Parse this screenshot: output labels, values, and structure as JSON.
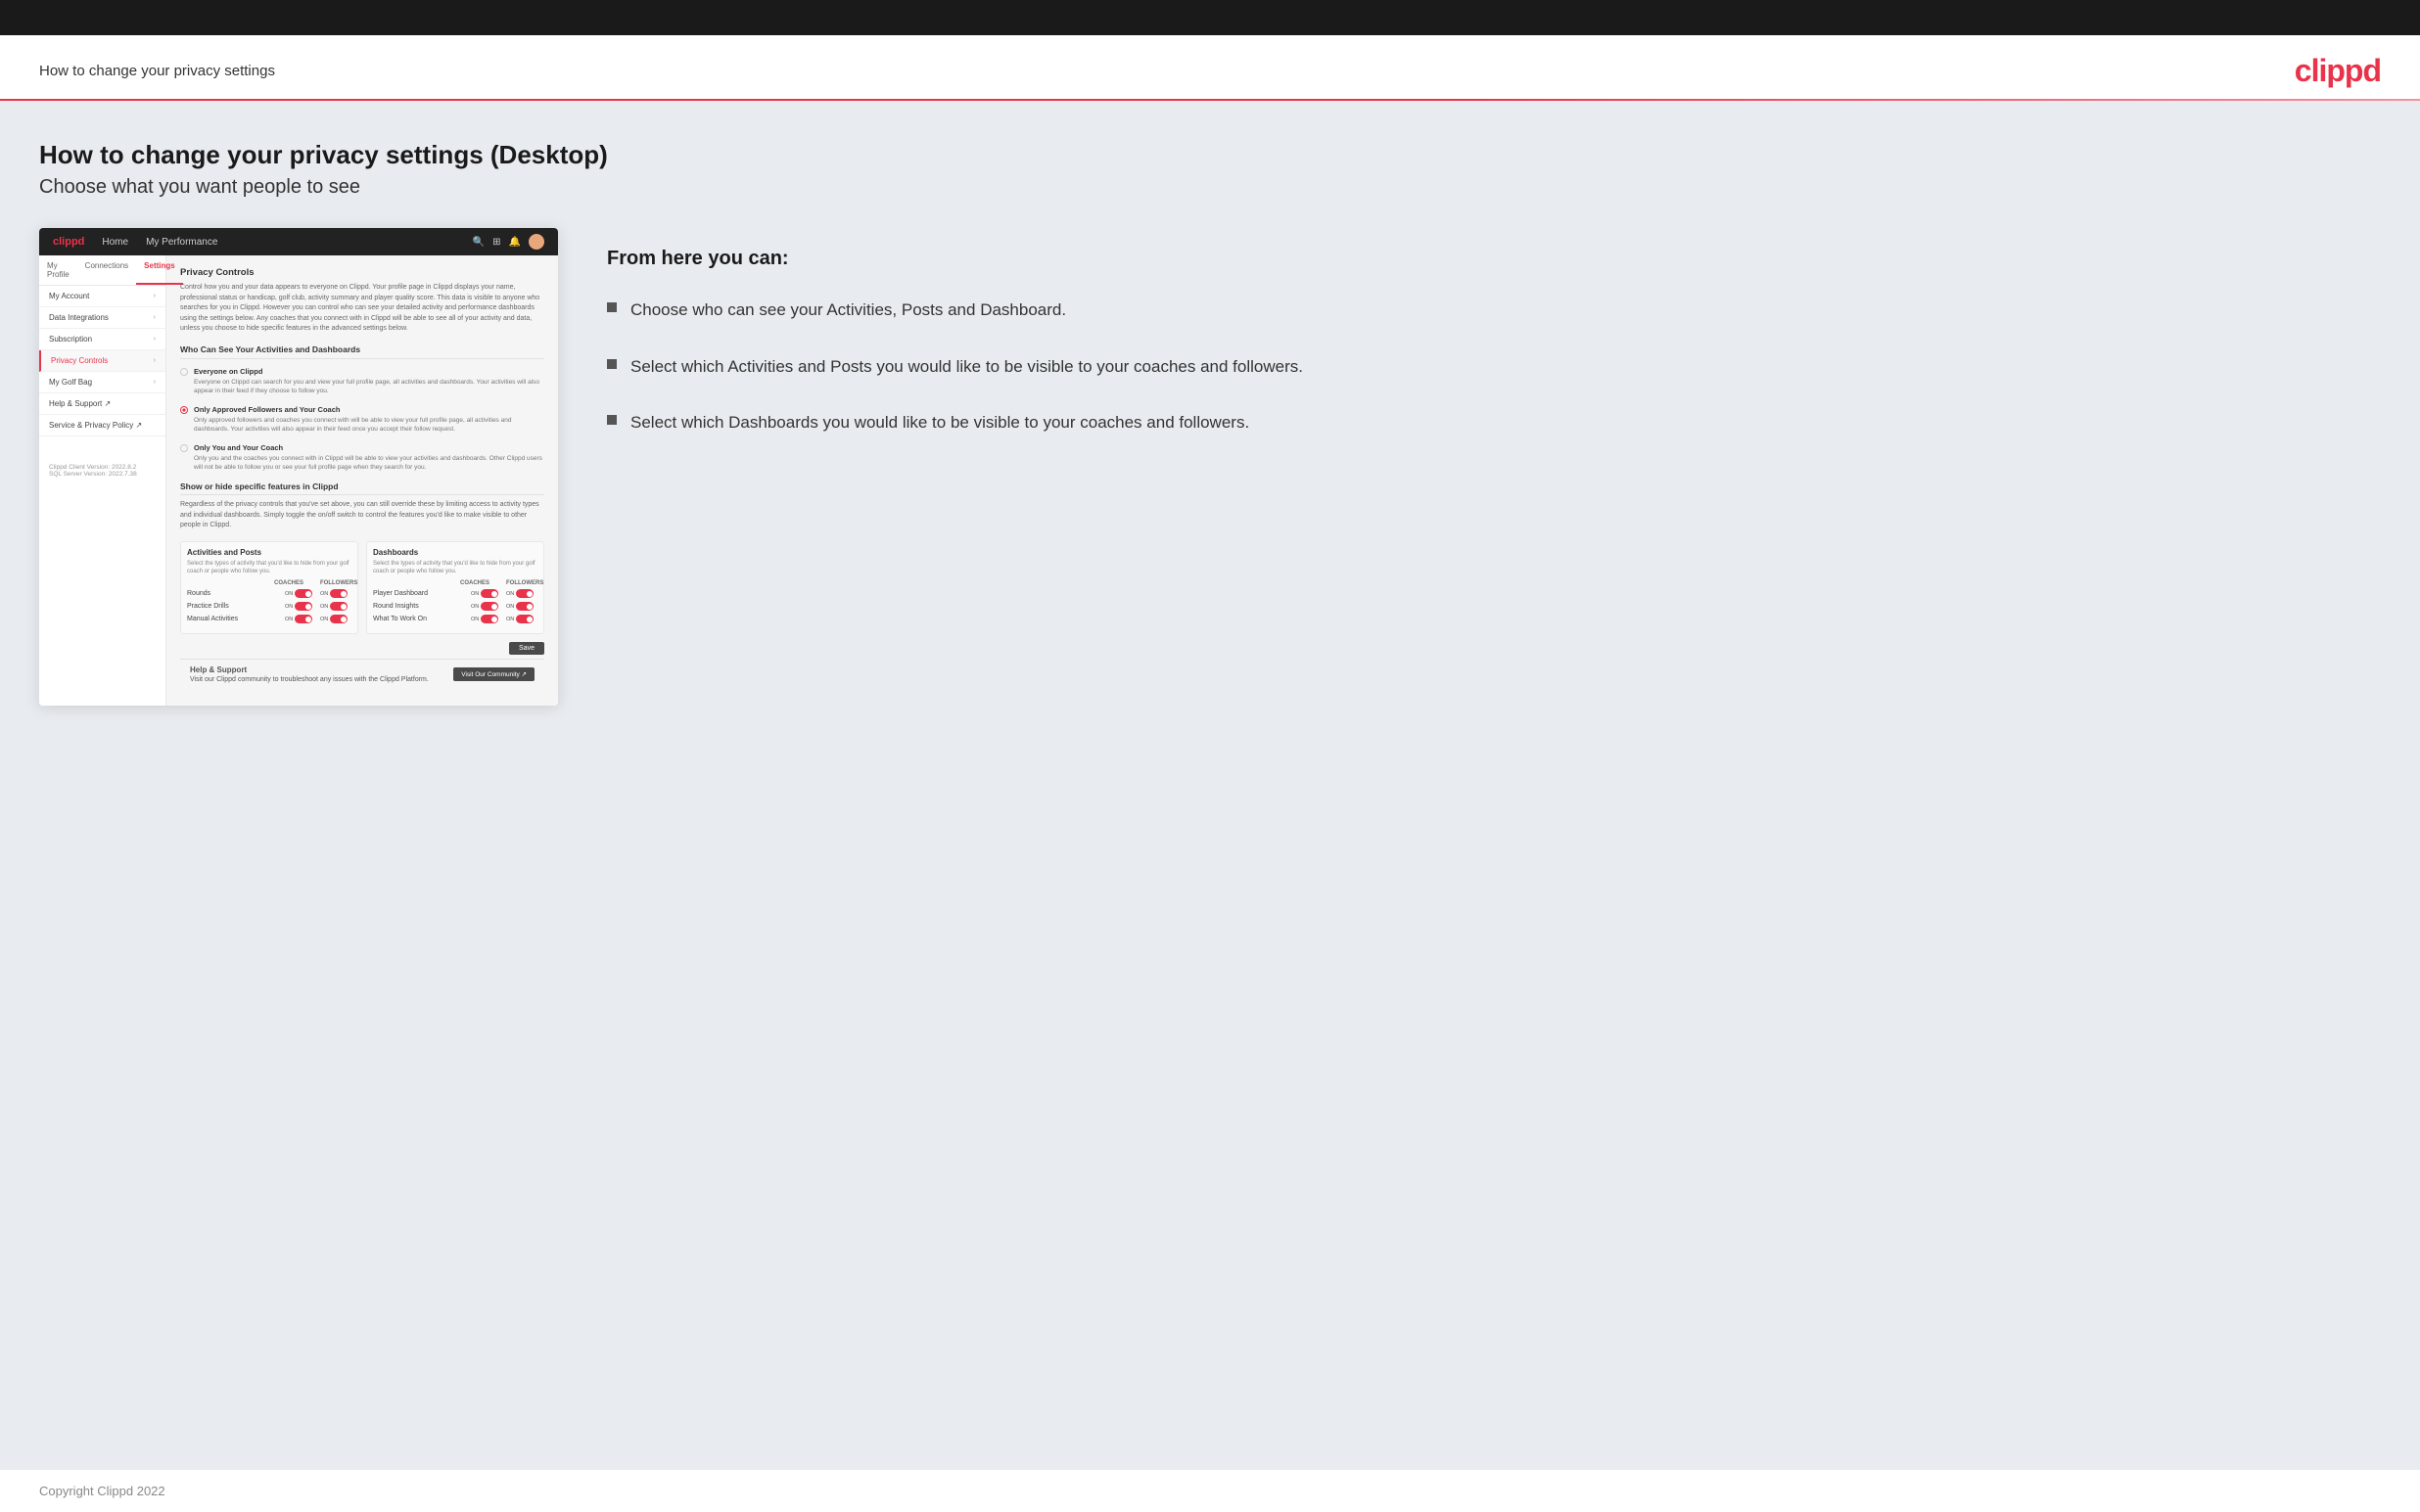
{
  "topBar": {},
  "header": {
    "title": "How to change your privacy settings",
    "logo": "clippd"
  },
  "content": {
    "title": "How to change your privacy settings (Desktop)",
    "subtitle": "Choose what you want people to see"
  },
  "mockup": {
    "nav": {
      "logo": "clippd",
      "items": [
        "Home",
        "My Performance"
      ]
    },
    "sidebar": {
      "tabs": [
        "My Profile",
        "Connections",
        "Settings"
      ],
      "activeTab": "Settings",
      "items": [
        {
          "label": "My Account",
          "active": false
        },
        {
          "label": "Data Integrations",
          "active": false
        },
        {
          "label": "Subscription",
          "active": false
        },
        {
          "label": "Privacy Controls",
          "active": true
        },
        {
          "label": "My Golf Bag",
          "active": false
        },
        {
          "label": "Help & Support ↗",
          "active": false
        },
        {
          "label": "Service & Privacy Policy ↗",
          "active": false
        }
      ],
      "footer": {
        "line1": "Clippd Client Version: 2022.8.2",
        "line2": "SQL Server Version: 2022.7.38"
      }
    },
    "main": {
      "sectionTitle": "Privacy Controls",
      "description": "Control how you and your data appears to everyone on Clippd. Your profile page in Clippd displays your name, professional status or handicap, golf club, activity summary and player quality score. This data is visible to anyone who searches for you in Clippd. However you can control who can see your detailed activity and performance dashboards using the settings below. Any coaches that you connect with in Clippd will be able to see all of your activity and data, unless you choose to hide specific features in the advanced settings below.",
      "whoTitle": "Who Can See Your Activities and Dashboards",
      "radioOptions": [
        {
          "id": "everyone",
          "label": "Everyone on Clippd",
          "desc": "Everyone on Clippd can search for you and view your full profile page, all activities and dashboards. Your activities will also appear in their feed if they choose to follow you.",
          "selected": false
        },
        {
          "id": "followers",
          "label": "Only Approved Followers and Your Coach",
          "desc": "Only approved followers and coaches you connect with will be able to view your full profile page, all activities and dashboards. Your activities will also appear in their feed once you accept their follow request.",
          "selected": true
        },
        {
          "id": "coach",
          "label": "Only You and Your Coach",
          "desc": "Only you and the coaches you connect with in Clippd will be able to view your activities and dashboards. Other Clippd users will not be able to follow you or see your full profile page when they search for you.",
          "selected": false
        }
      ],
      "showHideTitle": "Show or hide specific features in Clippd",
      "showHideDesc": "Regardless of the privacy controls that you've set above, you can still override these by limiting access to activity types and individual dashboards. Simply toggle the on/off switch to control the features you'd like to make visible to other people in Clippd.",
      "activitiesPanelTitle": "Activities and Posts",
      "activitiesPanelDesc": "Select the types of activity that you'd like to hide from your golf coach or people who follow you.",
      "dashboardsPanelTitle": "Dashboards",
      "dashboardsPanelDesc": "Select the types of activity that you'd like to hide from your golf coach or people who follow you.",
      "colLabels": [
        "COACHES",
        "FOLLOWERS"
      ],
      "activityRows": [
        {
          "label": "Rounds"
        },
        {
          "label": "Practice Drills"
        },
        {
          "label": "Manual Activities"
        }
      ],
      "dashboardRows": [
        {
          "label": "Player Dashboard"
        },
        {
          "label": "Round Insights"
        },
        {
          "label": "What To Work On"
        }
      ],
      "saveLabel": "Save",
      "helpTitle": "Help & Support",
      "helpDesc": "Visit our Clippd community to troubleshoot any issues with the Clippd Platform.",
      "helpBtnLabel": "Visit Our Community ↗"
    }
  },
  "rightPanel": {
    "fromHereTitle": "From here you can:",
    "bullets": [
      {
        "text": "Choose who can see your Activities, Posts and Dashboard."
      },
      {
        "text": "Select which Activities and Posts you would like to be visible to your coaches and followers."
      },
      {
        "text": "Select which Dashboards you would like to be visible to your coaches and followers."
      }
    ]
  },
  "footer": {
    "copyright": "Copyright Clippd 2022"
  }
}
